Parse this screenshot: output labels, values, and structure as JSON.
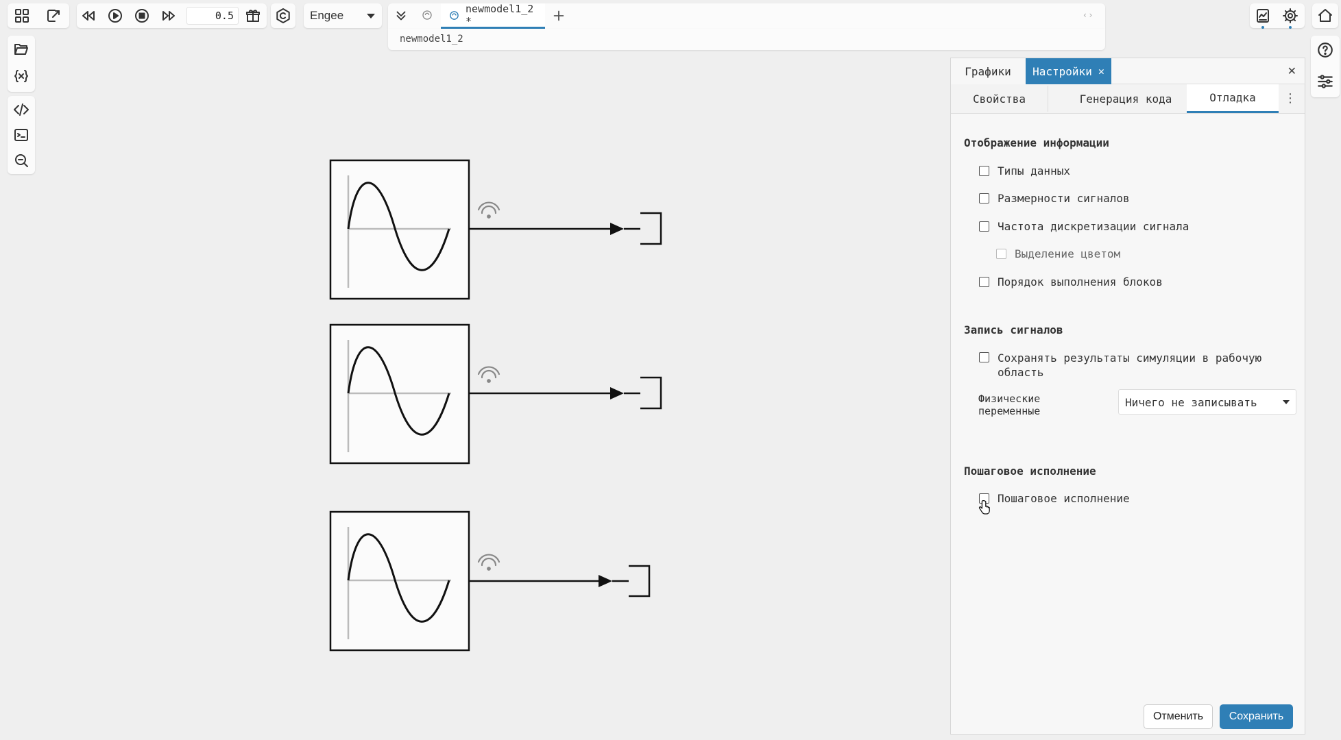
{
  "toolbar": {
    "time_value": "0.5",
    "target_select": "Engee",
    "model_tab": "newmodel1_2 *",
    "breadcrumb": "newmodel1_2",
    "icons": [
      "grid-icon",
      "export-icon",
      "rewind-icon",
      "play-icon",
      "stop-icon",
      "fast-forward-icon",
      "gift-icon",
      "copyright-icon",
      "double-chevron-icon",
      "model-icon",
      "plus-icon"
    ]
  },
  "panel": {
    "top_tabs": [
      {
        "label": "Графики"
      },
      {
        "label": "Настройки"
      }
    ],
    "sub_tabs": [
      {
        "label": "Свойства"
      },
      {
        "label": "Генерация кода"
      },
      {
        "label": "Отладка"
      }
    ],
    "info_section": {
      "title": "Отображение информации",
      "options": [
        "Типы данных",
        "Размерности сигналов",
        "Частота дискретизации сигнала",
        "Выделение цветом",
        "Порядок выполнения блоков"
      ]
    },
    "logging_section": {
      "title": "Запись сигналов",
      "save_option": "Сохранять результаты симуляции в рабочую область",
      "phys_label": "Физические переменные",
      "phys_value": "Ничего не записывать"
    },
    "step_section": {
      "title": "Пошаговое исполнение",
      "option": "Пошаговое исполнение"
    },
    "cancel_label": "Отменить",
    "save_label": "Сохранить"
  },
  "colors": {
    "accent": "#2f7fb6",
    "canvas": "#efefef"
  }
}
